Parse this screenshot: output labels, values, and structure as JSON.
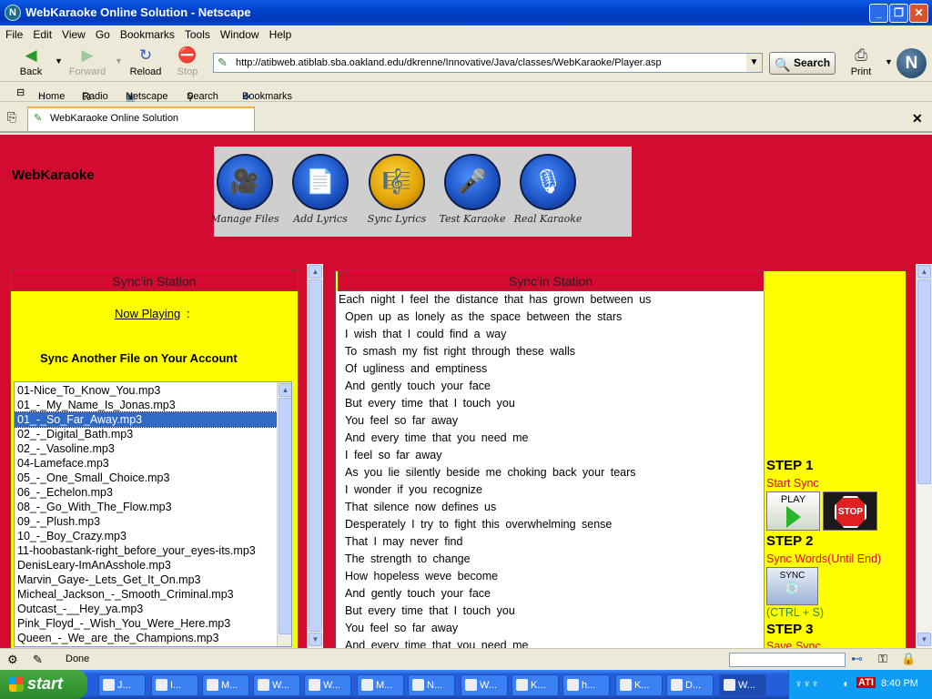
{
  "window": {
    "title": "WebKaraoke Online Solution - Netscape"
  },
  "menu": [
    "File",
    "Edit",
    "View",
    "Go",
    "Bookmarks",
    "Tools",
    "Window",
    "Help"
  ],
  "nav": {
    "back": "Back",
    "forward": "Forward",
    "reload": "Reload",
    "stop": "Stop",
    "search": "Search",
    "print": "Print"
  },
  "address": {
    "url": "http://atibweb.atiblab.sba.oakland.edu/dkrenne/Innovative/Java/classes/WebKaraoke/Player.asp"
  },
  "personal_toolbar": [
    "Home",
    "Radio",
    "Netscape",
    "Search",
    "Bookmarks"
  ],
  "tab": {
    "label": "WebKaraoke Online Solution"
  },
  "page": {
    "brand": "WebKaraoke",
    "tools": [
      "Manage Files",
      "Add Lyrics",
      "Sync Lyrics",
      "Test Karaoke",
      "Real Karaoke"
    ],
    "left_panel": {
      "header": "Sync'in Station",
      "now_playing": "Now Playing",
      "now_playing_colon": ":",
      "sync_another": "Sync Another File on Your Account",
      "files": [
        "01-Nice_To_Know_You.mp3",
        "01_-_My_Name_Is_Jonas.mp3",
        "01_-_So_Far_Away.mp3",
        "02_-_Digital_Bath.mp3",
        "02_-_Vasoline.mp3",
        "04-Lameface.mp3",
        "05_-_One_Small_Choice.mp3",
        "06_-_Echelon.mp3",
        "08_-_Go_With_The_Flow.mp3",
        "09_-_Plush.mp3",
        "10_-_Boy_Crazy.mp3",
        "11-hoobastank-right_before_your_eyes-its.mp3",
        "DenisLeary-ImAnAsshole.mp3",
        "Marvin_Gaye-_Lets_Get_It_On.mp3",
        "Micheal_Jackson_-_Smooth_Criminal.mp3",
        "Outcast_-__Hey_ya.mp3",
        "Pink_Floyd_-_Wish_You_Were_Here.mp3",
        "Queen_-_We_are_the_Champions.mp3"
      ],
      "selected_file": "01_-_So_Far_Away.mp3"
    },
    "right_panel": {
      "header": "Sync'in Station",
      "lyrics": [
        "Each night I feel the distance that has grown between us",
        "Open up as lonely as the space between the stars",
        "I wish that I could find a way",
        "To smash my fist right through these walls",
        "Of ugliness and emptiness",
        "And gently touch your face",
        "But every time that I touch you",
        "You feel so far away",
        "And every time that you need me",
        "I feel so far away",
        "As you lie silently beside me choking back your tears",
        "I wonder if you recognize",
        "That silence now defines us",
        "Desperately I try to fight this overwhelming sense",
        "That I may never find",
        "The strength to change",
        "How hopeless weve become",
        "And gently touch your face",
        "But every time that I touch you",
        "You feel so far away",
        "And every time that you need me"
      ],
      "step1": "STEP 1",
      "start_sync": "Start Sync",
      "play_label": "PLAY",
      "stop_label": "STOP",
      "step2": "STEP 2",
      "sync_words": "Sync Words(Until End)",
      "sync_label": "SYNC",
      "shortcut": "(CTRL + S)",
      "step3": "STEP 3",
      "save_sync": "Save Sync"
    }
  },
  "status": {
    "text": "Done"
  },
  "taskbar": {
    "start": "start",
    "items": [
      "J...",
      "I...",
      "M...",
      "W...",
      "W...",
      "M...",
      "N...",
      "W...",
      "K...",
      "h...",
      "K...",
      "D...",
      "W..."
    ],
    "clock": "8:40 PM"
  },
  "colors": {
    "page_bg": "#d30b30",
    "panel_bg": "#ffff00",
    "selection": "#3169c6"
  }
}
